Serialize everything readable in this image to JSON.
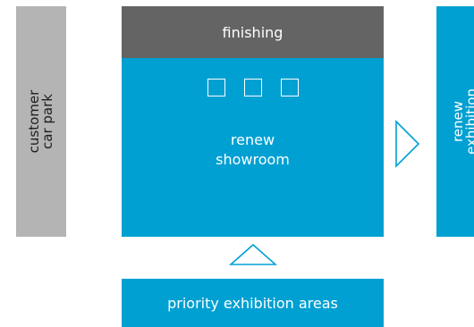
{
  "car_park": {
    "line1": "customer",
    "line2": "car park"
  },
  "finishing": {
    "label": "finishing"
  },
  "showroom": {
    "line1": "renew",
    "line2": "showroom",
    "square_count": 3
  },
  "exhibition": {
    "line1": "renew",
    "line2": "exhibition"
  },
  "priority": {
    "label": "priority exhibition areas"
  },
  "colors": {
    "blue": "#00a0d2",
    "dark_grey": "#646464",
    "light_grey": "#b4b4b4",
    "text_dark": "#1e1e1e"
  }
}
